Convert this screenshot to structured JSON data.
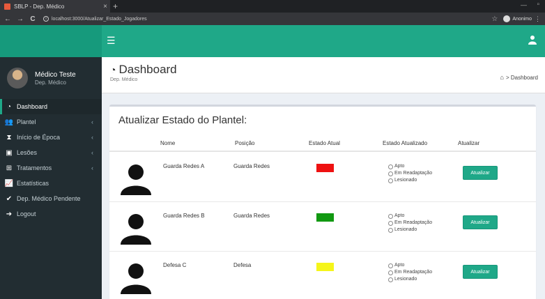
{
  "browser": {
    "tab_title": "SBLP - Dep. Médico",
    "tab_close": "×",
    "new_tab": "+",
    "url": "localhost:3000/Atualizar_Estado_Jogadores",
    "profile_name": "Anonimo",
    "icons": {
      "back": "back-arrow-icon",
      "forward": "forward-arrow-icon",
      "reload": "reload-icon",
      "info": "info-icon",
      "star": "star-icon",
      "menu": "kebab-menu-icon"
    }
  },
  "app": {
    "accent_color": "#1fa888",
    "sidebar_color": "#222d32"
  },
  "user": {
    "name": "Médico Teste",
    "role": "Dep. Médico"
  },
  "sidebar": {
    "items": [
      {
        "label": "Dashboard",
        "icon": "dashboard-icon",
        "has_children": false,
        "active": true
      },
      {
        "label": "Plantel",
        "icon": "users-icon",
        "has_children": true,
        "active": false
      },
      {
        "label": "Início de Época",
        "icon": "hourglass-icon",
        "has_children": true,
        "active": false
      },
      {
        "label": "Lesões",
        "icon": "medkit-icon",
        "has_children": true,
        "active": false
      },
      {
        "label": "Tratamentos",
        "icon": "plus-square-icon",
        "has_children": true,
        "active": false
      },
      {
        "label": "Estatísticas",
        "icon": "line-chart-icon",
        "has_children": false,
        "active": false
      },
      {
        "label": "Dep. Médico Pendente",
        "icon": "check-icon",
        "has_children": false,
        "active": false
      },
      {
        "label": "Logout",
        "icon": "sign-out-icon",
        "has_children": false,
        "active": false
      }
    ]
  },
  "header": {
    "title": "Dashboard",
    "subtitle": "Dep. Médico",
    "breadcrumb": "Dashboard"
  },
  "box": {
    "title": "Atualizar Estado do Plantel:",
    "columns": {
      "name": "Nome",
      "position": "Posição",
      "current_status": "Estado Atual",
      "updated_status": "Estado Atualizado",
      "update": "Atualizar"
    },
    "rows": [
      {
        "name": "Guarda Redes A",
        "position": "Guarda Redes",
        "status_color": "#ee1111",
        "options": [
          "Apto",
          "Em Readaptação",
          "Lesionado"
        ],
        "button": "Atualizar"
      },
      {
        "name": "Guarda Redes B",
        "position": "Guarda Redes",
        "status_color": "#119911",
        "options": [
          "Apto",
          "Em Readaptação",
          "Lesionado"
        ],
        "button": "Atualizar"
      },
      {
        "name": "Defesa C",
        "position": "Defesa",
        "status_color": "#f5f51a",
        "options": [
          "Apto",
          "Em Readaptação",
          "Lesionado"
        ],
        "button": "Atualizar"
      }
    ]
  }
}
